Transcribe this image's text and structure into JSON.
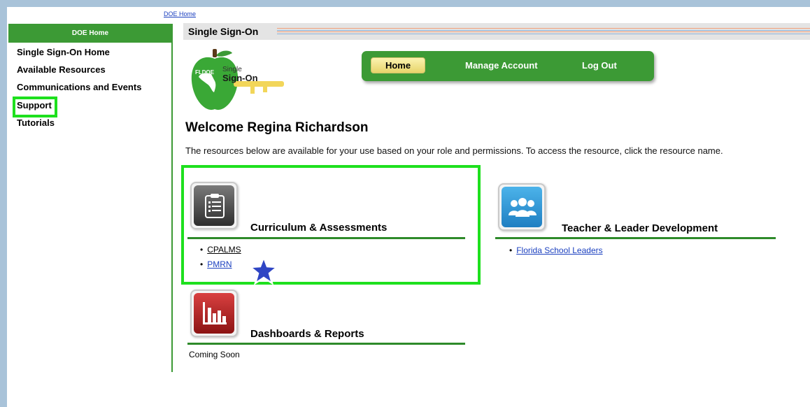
{
  "header": {
    "doe_home_link": "DOE Home"
  },
  "sidebar": {
    "header": "DOE Home",
    "items": [
      {
        "label": "Single Sign-On Home"
      },
      {
        "label": "Available Resources"
      },
      {
        "label": "Communications and Events"
      },
      {
        "label": "Support"
      },
      {
        "label": "Tutorials"
      }
    ]
  },
  "title_bar": {
    "title": "Single Sign-On"
  },
  "logo": {
    "badge": "FLDOE",
    "line1": "Single",
    "line2": "Sign-On"
  },
  "tabs": {
    "home": "Home",
    "manage": "Manage Account",
    "logout": "Log Out"
  },
  "welcome": "Welcome Regina Richardson",
  "intro": "The resources below are available for your use based on your role and permissions. To access the resource, click the resource name.",
  "resources": {
    "curriculum": {
      "title": "Curriculum & Assessments",
      "links": [
        "CPALMS",
        "PMRN"
      ]
    },
    "teacher": {
      "title": "Teacher & Leader Development",
      "links": [
        "Florida School Leaders"
      ]
    },
    "dashboards": {
      "title": "Dashboards & Reports",
      "note": "Coming Soon"
    }
  },
  "bullet": "•",
  "colors": {
    "accent_green": "#3c9a35",
    "highlight": "#1ee01e",
    "link_blue": "#1a3fbf",
    "home_tab": "#f5e78c"
  },
  "icons": {
    "curriculum": "clipboard-icon",
    "teacher": "people-group-icon",
    "dashboards": "bar-chart-icon",
    "marker": "star-icon",
    "logo": "apple-key-logo"
  }
}
